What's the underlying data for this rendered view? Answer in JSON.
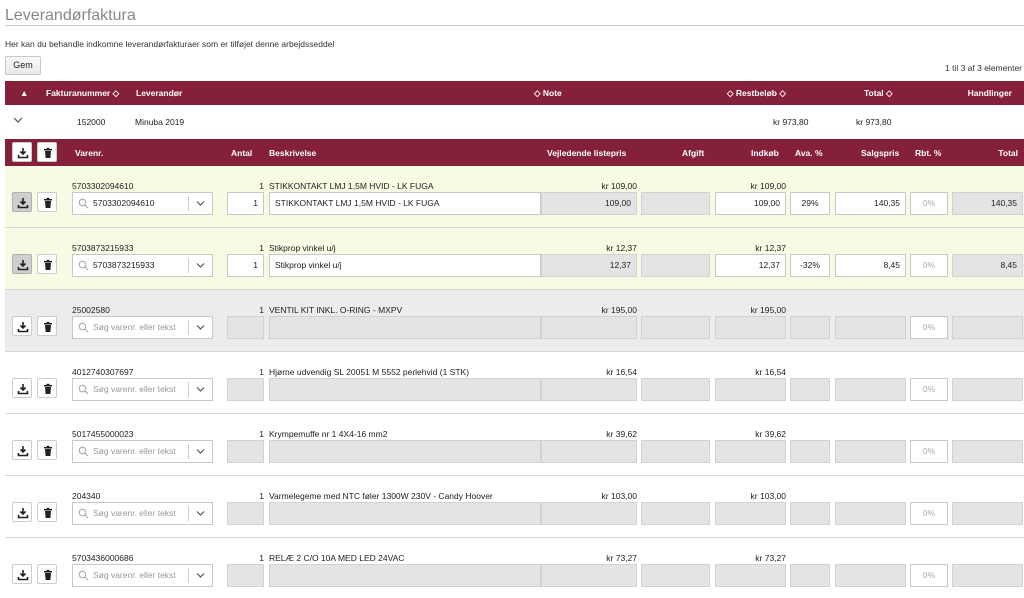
{
  "page": {
    "title": "Leverandørfaktura",
    "description": "Her kan du behandle indkomne leverandørfakturaer som er tilføjet denne arbejdsseddel",
    "save_label": "Gem",
    "paging": "1 til 3 af 3 elementer"
  },
  "main_table": {
    "headers": {
      "sort_indicator": "▲",
      "invoice_number": "Fakturanummer ◇",
      "supplier": "Leverandør",
      "note": "◇ Note",
      "remaining": "◇   Restbeløb ◇",
      "total": "Total ◇",
      "actions": "Handlinger"
    },
    "invoice": {
      "expand_icon": "chevron-down",
      "number": "152000",
      "supplier": "Minuba 2019",
      "remaining": "kr 973,80",
      "total": "kr 973,80"
    }
  },
  "lines_table": {
    "headers": {
      "item_no": "Varenr.",
      "qty": "Antal",
      "description": "Beskrivelse",
      "list_price": "Vejledende listepris",
      "fee": "Afgift",
      "purchase": "Indkøb",
      "markup": "Ava. %",
      "sale_price": "Salgspris",
      "discount": "Rbt. %",
      "total": "Total"
    },
    "rows": [
      {
        "style": "green",
        "active": true,
        "item_no": "5703302094610",
        "qty": "1",
        "desc": "STIKKONTAKT LMJ 1,5M HVID - LK FUGA",
        "list_price": "kr 109,00",
        "purchase": "kr 109,00",
        "select_value": "5703302094610",
        "qty_value": "1",
        "desc_value": "STIKKONTAKT LMJ 1,5M HVID - LK FUGA",
        "list_value": "109,00",
        "fee_value": "",
        "purchase_value": "109,00",
        "markup_value": "29%",
        "sale_value": "140,35",
        "discount_value": "0%",
        "total_value": "140,35"
      },
      {
        "style": "green",
        "active": true,
        "item_no": "5703873215933",
        "qty": "1",
        "desc": "Stikprop vinkel u/j",
        "list_price": "kr 12,37",
        "purchase": "kr 12,37",
        "select_value": "5703873215933",
        "qty_value": "1",
        "desc_value": "Stikprop vinkel u/j",
        "list_value": "12,37",
        "fee_value": "",
        "purchase_value": "12,37",
        "markup_value": "-32%",
        "sale_value": "8,45",
        "discount_value": "0%",
        "total_value": "8,45"
      },
      {
        "style": "grey",
        "active": false,
        "item_no": "25002580",
        "qty": "1",
        "desc": "VENTIL KIT INKL. O-RING - MXPV",
        "list_price": "kr 195,00",
        "purchase": "kr 195,00",
        "select_value": "",
        "qty_value": "",
        "desc_value": "",
        "list_value": "",
        "fee_value": "",
        "purchase_value": "",
        "markup_value": "",
        "sale_value": "",
        "discount_value": "0%",
        "total_value": ""
      },
      {
        "style": "white",
        "active": false,
        "item_no": "4012740307697",
        "qty": "1",
        "desc": "Hjørne udvendig SL 20051 M 5552 perlehvid (1 STK)",
        "list_price": "kr 16,54",
        "purchase": "kr 16,54",
        "select_value": "",
        "qty_value": "",
        "desc_value": "",
        "list_value": "",
        "fee_value": "",
        "purchase_value": "",
        "markup_value": "",
        "sale_value": "",
        "discount_value": "0%",
        "total_value": ""
      },
      {
        "style": "white",
        "active": false,
        "item_no": "5017455000023",
        "qty": "1",
        "desc": "Krympemuffe nr 1 4X4-16 mm2",
        "list_price": "kr 39,62",
        "purchase": "kr 39,62",
        "select_value": "",
        "qty_value": "",
        "desc_value": "",
        "list_value": "",
        "fee_value": "",
        "purchase_value": "",
        "markup_value": "",
        "sale_value": "",
        "discount_value": "0%",
        "total_value": ""
      },
      {
        "style": "white",
        "active": false,
        "item_no": "204340",
        "qty": "1",
        "desc": "Varmelegeme med NTC føler 1300W 230V - Candy Hoover",
        "list_price": "kr 103,00",
        "purchase": "kr 103,00",
        "select_value": "",
        "qty_value": "",
        "desc_value": "",
        "list_value": "",
        "fee_value": "",
        "purchase_value": "",
        "markup_value": "",
        "sale_value": "",
        "discount_value": "0%",
        "total_value": ""
      },
      {
        "style": "white",
        "active": false,
        "item_no": "5703436000686",
        "qty": "1",
        "desc": "RELÆ 2 C/O 10A MED LED 24VAC",
        "list_price": "kr 73,27",
        "purchase": "kr 73,27",
        "select_value": "",
        "qty_value": "",
        "desc_value": "",
        "list_value": "",
        "fee_value": "",
        "purchase_value": "",
        "markup_value": "",
        "sale_value": "",
        "discount_value": "0%",
        "total_value": ""
      }
    ],
    "search_placeholder": "Søg varenr. eller tekst"
  },
  "colors": {
    "header": "#85203b",
    "matched_row": "#f6fbe3",
    "unmatched_row": "#ececec"
  },
  "icons": {
    "import": "download-icon",
    "delete": "trash-icon",
    "search": "search-icon",
    "dropdown": "chevron-down-icon"
  }
}
